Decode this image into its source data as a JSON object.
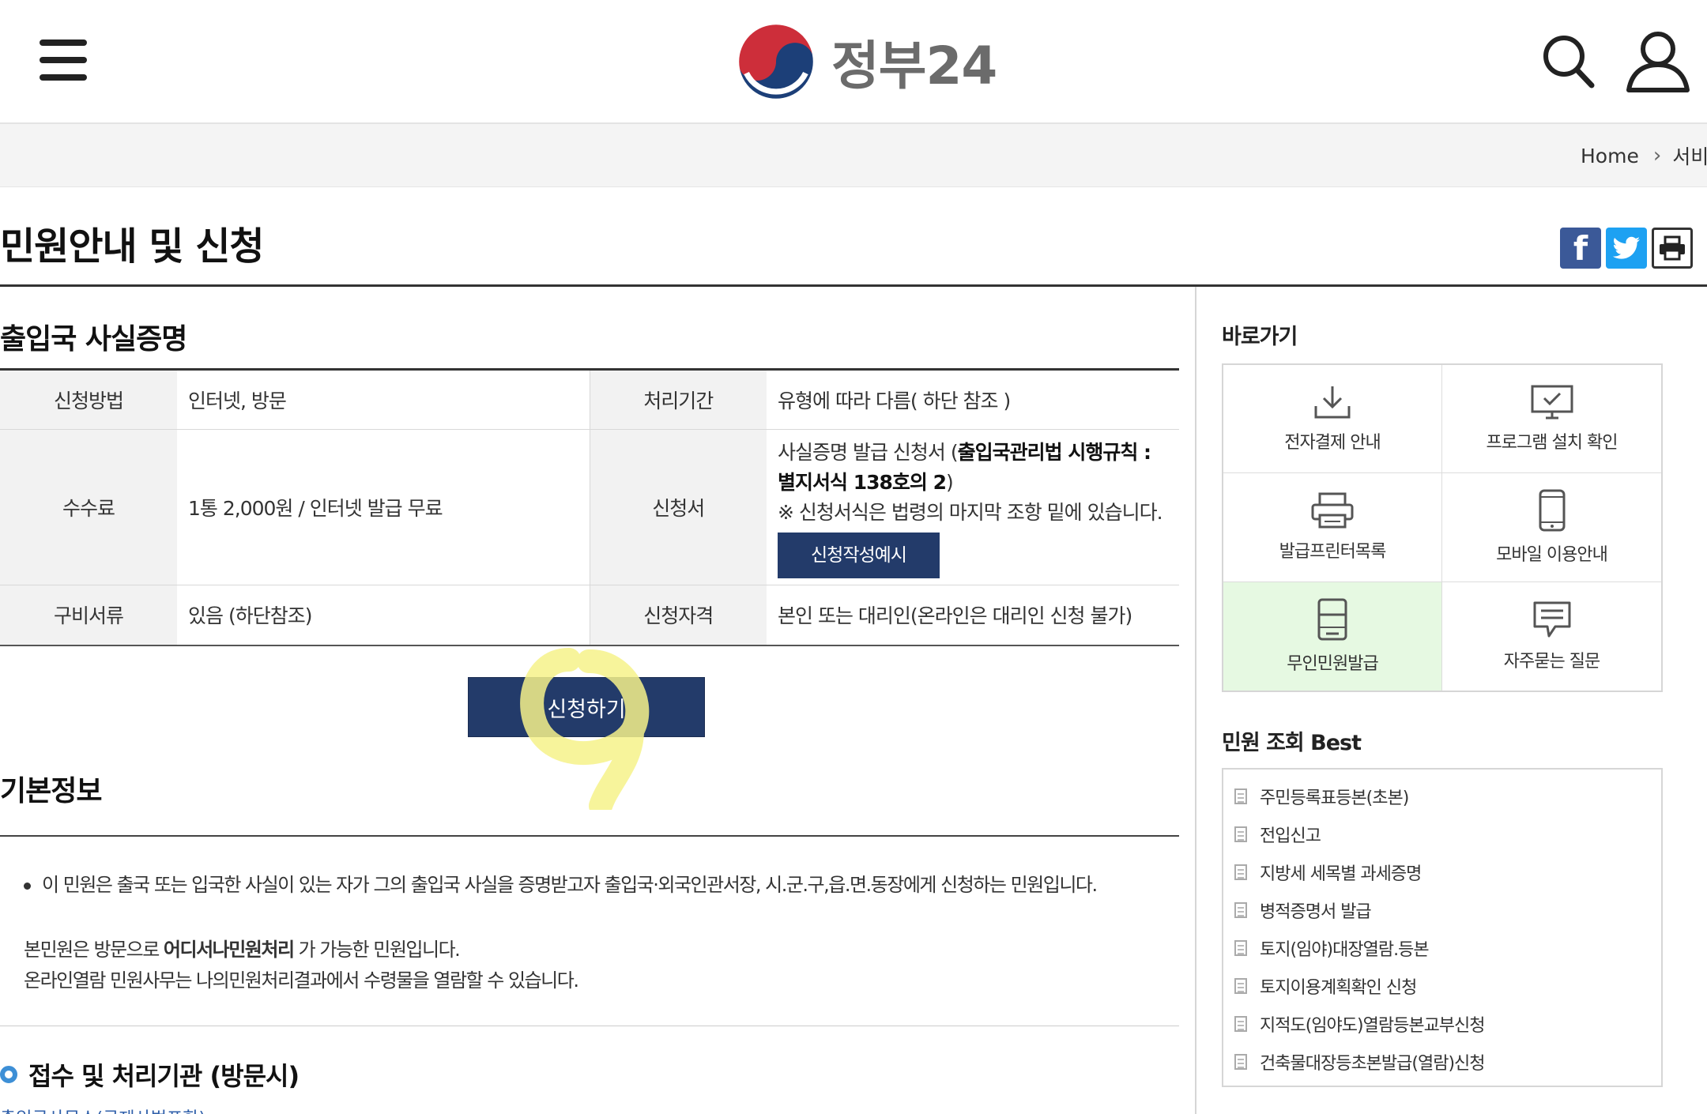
{
  "header": {
    "logo_text": "정부24"
  },
  "breadcrumb": {
    "home": "Home",
    "current": "서비스"
  },
  "page": {
    "title": "민원안내 및 신청"
  },
  "service": {
    "title": "출입국 사실증명",
    "rows": {
      "method_label": "신청방법",
      "method_value": "인터넷, 방문",
      "period_label": "처리기간",
      "period_value": "유형에 따라 다름( 하단 참조 )",
      "fee_label": "수수료",
      "fee_value": "1통 2,000원 / 인터넷 발급 무료",
      "form_label": "신청서",
      "form_value_prefix": "사실증명 발급 신청서 (",
      "form_value_bold": "출입국관리법 시행규칙 : 별지서식 138호의 2",
      "form_value_suffix": ")",
      "form_note": "※ 신청서식은 법령의 마지막 조항 밑에 있습니다.",
      "form_example_button": "신청작성예시",
      "docs_label": "구비서류",
      "docs_value": "있음 (하단참조)",
      "qual_label": "신청자격",
      "qual_value": "본인 또는 대리인(온라인은 대리인 신청 불가)"
    },
    "apply_button": "신청하기"
  },
  "basic_info": {
    "title": "기본정보",
    "bullet": "이 민원은 출국 또는 입국한 사실이 있는 자가 그의 출입국 사실을 증명받고자 출입국·외국인관서장, 시.군.구,읍.면.동장에게 신청하는 민원입니다.",
    "note1_prefix": "본민원은 방문으로 ",
    "note1_bold": "어디서나민원처리",
    "note1_suffix": " 가 가능한 민원입니다.",
    "note2": "온라인열람 민원사무는 나의민원처리결과에서 수령물을 열람할 수 있습니다."
  },
  "reception": {
    "title": "접수 및 처리기관 (방문시)",
    "cutoff_text": "출입국사무소(국제사법포함)"
  },
  "sidebar": {
    "quick_title": "바로가기",
    "quick_items": [
      {
        "label": "전자결제 안내",
        "icon": "download-icon"
      },
      {
        "label": "프로그램 설치 확인",
        "icon": "monitor-check-icon"
      },
      {
        "label": "발급프린터목록",
        "icon": "printer-icon"
      },
      {
        "label": "모바일 이용안내",
        "icon": "mobile-icon"
      },
      {
        "label": "무인민원발급",
        "icon": "kiosk-icon"
      },
      {
        "label": "자주묻는 질문",
        "icon": "chat-icon"
      }
    ],
    "best_title": "민원 조회 Best",
    "best_items": [
      "주민등록표등본(초본)",
      "전입신고",
      "지방세 세목별 과세증명",
      "병적증명서 발급",
      "토지(임야)대장열람.등본",
      "토지이용계획확인 신청",
      "지적도(임야도)열람등본교부신청",
      "건축물대장등초본발급(열람)신청"
    ]
  },
  "colors": {
    "primary_navy": "#233b6a",
    "active_green_bg": "#e6f9e2",
    "facebook": "#3b5998",
    "twitter": "#1da1f2",
    "highlight_yellow": "#f6f28a"
  }
}
